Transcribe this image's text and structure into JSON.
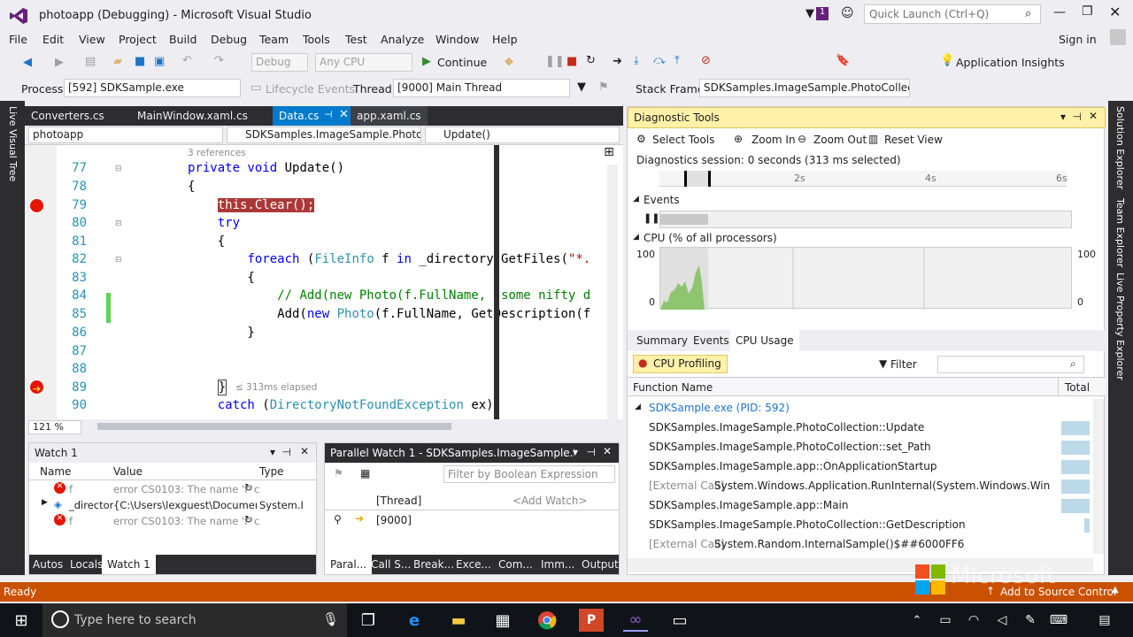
{
  "window": {
    "title": "photoapp (Debugging) - Microsoft Visual Studio",
    "notif_count": "1",
    "quick_launch_placeholder": "Quick Launch (Ctrl+Q)",
    "sign_in": "Sign in"
  },
  "menu": [
    "File",
    "Edit",
    "View",
    "Project",
    "Build",
    "Debug",
    "Team",
    "Tools",
    "Test",
    "Analyze",
    "Window",
    "Help"
  ],
  "toolbar": {
    "config": "Debug",
    "platform": "Any CPU",
    "continue": "Continue",
    "app_insights": "Application Insights"
  },
  "debugbar": {
    "process_label": "Process:",
    "process_value": "[592] SDKSample.exe",
    "lifecycle": "Lifecycle Events",
    "thread_label": "Thread:",
    "thread_value": "[9000] Main Thread",
    "stackframe_label": "Stack Frame:",
    "stackframe_value": "SDKSamples.ImageSample.PhotoCollectic"
  },
  "side_left": [
    "Live Visual Tree"
  ],
  "side_right": [
    "Solution Explorer",
    "Team Explorer",
    "Live Property Explorer"
  ],
  "doc_tabs": [
    "Converters.cs",
    "MainWindow.xaml.cs",
    "Data.cs",
    "app.xaml.cs"
  ],
  "nav": {
    "project": "photoapp",
    "class": "SDKSamples.ImageSample.PhotoC",
    "member": "Update()"
  },
  "editor": {
    "zoom": "121 %",
    "references": "3 references",
    "elapsed": "≤ 313ms elapsed",
    "lines": [
      "77",
      "78",
      "79",
      "80",
      "81",
      "82",
      "83",
      "84",
      "85",
      "86",
      "87",
      "88",
      "89",
      "90"
    ]
  },
  "watch": {
    "title": "Watch 1",
    "columns": [
      "Name",
      "Value",
      "Type"
    ],
    "rows": [
      {
        "name": "f",
        "value": "error CS0103: The name 'f' c",
        "type": ""
      },
      {
        "name": "_director",
        "value": "{C:\\Users\\lexguest\\Documents\\",
        "type": "System.IO"
      },
      {
        "name": "f",
        "value": "error CS0103: The name 'f' c",
        "type": ""
      }
    ],
    "tabs": [
      "Autos",
      "Locals",
      "Watch 1"
    ]
  },
  "parallel": {
    "title": "Parallel Watch 1 - SDKSamples.ImageSample.Phot...",
    "filter_placeholder": "Filter by Boolean Expression",
    "col_thread": "[Thread]",
    "col_add": "<Add Watch>",
    "row_thread": "[9000]",
    "tabs": [
      "Paral...",
      "Call S...",
      "Break...",
      "Exce...",
      "Com...",
      "Imm...",
      "Output"
    ]
  },
  "diag": {
    "title": "Diagnostic Tools",
    "select_tools": "Select Tools",
    "zoom_in": "Zoom In",
    "zoom_out": "Zoom Out",
    "reset_view": "Reset View",
    "session": "Diagnostics session: 0 seconds (313 ms selected)",
    "ticks": [
      "2s",
      "4s",
      "6s"
    ],
    "events": "Events",
    "cpu": "CPU (% of all processors)",
    "cpu_max": "100",
    "cpu_min": "0",
    "tabs": [
      "Summary",
      "Events",
      "CPU Usage"
    ],
    "cpu_profiling": "CPU Profiling",
    "filter": "Filter",
    "col_function": "Function Name",
    "col_total": "Total",
    "rows": [
      {
        "prefix": "",
        "name": "SDKSample.exe (PID: 592)"
      },
      {
        "prefix": "",
        "name": "SDKSamples.ImageSample.PhotoCollection::Update"
      },
      {
        "prefix": "",
        "name": "SDKSamples.ImageSample.PhotoCollection::set_Path"
      },
      {
        "prefix": "",
        "name": "SDKSamples.ImageSample.app::OnApplicationStartup"
      },
      {
        "prefix": "[External Call]",
        "name": "System.Windows.Application.RunInternal(System.Windows.Window)$#..."
      },
      {
        "prefix": "",
        "name": "SDKSamples.ImageSample.app::Main"
      },
      {
        "prefix": "",
        "name": "SDKSamples.ImageSample.PhotoCollection::GetDescription"
      },
      {
        "prefix": "[External Call]",
        "name": "System.Random.InternalSample()$##6000FF6"
      }
    ]
  },
  "status": {
    "left": "Ready",
    "right": "Add to Source Control"
  },
  "watermark": "Microsoft",
  "taskbar": {
    "search_placeholder": "Type here to search"
  }
}
